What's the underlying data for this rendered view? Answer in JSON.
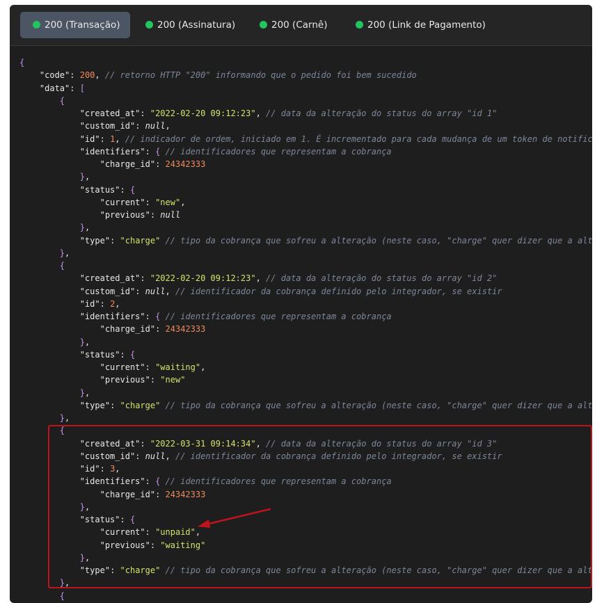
{
  "tabs": [
    {
      "label": "200 (Transação)",
      "active": true
    },
    {
      "label": "200 (Assinatura)",
      "active": false
    },
    {
      "label": "200 (Carnê)",
      "active": false
    },
    {
      "label": "200 (Link de Pagamento)",
      "active": false
    }
  ],
  "colors": {
    "status_dot": "#22c55e",
    "highlight_border": "#c0141b",
    "string": "#d5e36a",
    "number": "#f08a5d",
    "comment": "#7d8799"
  },
  "code_lines": [
    [
      [
        "b",
        "{"
      ]
    ],
    [
      [
        "p",
        "    "
      ],
      [
        "k",
        "\"code\""
      ],
      [
        "p",
        ": "
      ],
      [
        "n",
        "200"
      ],
      [
        "p",
        ", "
      ],
      [
        "c",
        "// retorno HTTP \"200\" informando que o pedido foi bem sucedido"
      ]
    ],
    [
      [
        "p",
        "    "
      ],
      [
        "k",
        "\"data\""
      ],
      [
        "p",
        ": "
      ],
      [
        "b",
        "["
      ]
    ],
    [
      [
        "p",
        "        "
      ],
      [
        "b",
        "{"
      ]
    ],
    [
      [
        "p",
        "            "
      ],
      [
        "k",
        "\"created_at\""
      ],
      [
        "p",
        ": "
      ],
      [
        "s",
        "\"2022-02-20 09:12:23\""
      ],
      [
        "p",
        ", "
      ],
      [
        "c",
        "// data da alteração do status do array \"id 1\""
      ]
    ],
    [
      [
        "p",
        "            "
      ],
      [
        "k",
        "\"custom_id\""
      ],
      [
        "p",
        ": "
      ],
      [
        "v",
        "null"
      ],
      [
        "p",
        ","
      ]
    ],
    [
      [
        "p",
        "            "
      ],
      [
        "k",
        "\"id\""
      ],
      [
        "p",
        ": "
      ],
      [
        "n",
        "1"
      ],
      [
        "p",
        ", "
      ],
      [
        "c",
        "// indicador de ordem, iniciado em 1. É incrementado para cada mudança de um token de notificação."
      ]
    ],
    [
      [
        "p",
        "            "
      ],
      [
        "k",
        "\"identifiers\""
      ],
      [
        "p",
        ": "
      ],
      [
        "b",
        "{"
      ],
      [
        "p",
        " "
      ],
      [
        "c",
        "// identificadores que representam a cobrança"
      ]
    ],
    [
      [
        "p",
        "                "
      ],
      [
        "k",
        "\"charge_id\""
      ],
      [
        "p",
        ": "
      ],
      [
        "n",
        "24342333"
      ]
    ],
    [
      [
        "p",
        "            "
      ],
      [
        "b",
        "}"
      ],
      [
        "p",
        ","
      ]
    ],
    [
      [
        "p",
        "            "
      ],
      [
        "k",
        "\"status\""
      ],
      [
        "p",
        ": "
      ],
      [
        "b",
        "{"
      ]
    ],
    [
      [
        "p",
        "                "
      ],
      [
        "k",
        "\"current\""
      ],
      [
        "p",
        ": "
      ],
      [
        "s",
        "\"new\""
      ],
      [
        "p",
        ","
      ]
    ],
    [
      [
        "p",
        "                "
      ],
      [
        "k",
        "\"previous\""
      ],
      [
        "p",
        ": "
      ],
      [
        "v",
        "null"
      ]
    ],
    [
      [
        "p",
        "            "
      ],
      [
        "b",
        "}"
      ],
      [
        "p",
        ","
      ]
    ],
    [
      [
        "p",
        "            "
      ],
      [
        "k",
        "\"type\""
      ],
      [
        "p",
        ": "
      ],
      [
        "s",
        "\"charge\""
      ],
      [
        "p",
        " "
      ],
      [
        "c",
        "// tipo da cobrança que sofreu a alteração (neste caso, \"charge\" quer dizer que a alteração"
      ]
    ],
    [
      [
        "p",
        "        "
      ],
      [
        "b",
        "}"
      ],
      [
        "p",
        ","
      ]
    ],
    [
      [
        "p",
        "        "
      ],
      [
        "b",
        "{"
      ]
    ],
    [
      [
        "p",
        "            "
      ],
      [
        "k",
        "\"created_at\""
      ],
      [
        "p",
        ": "
      ],
      [
        "s",
        "\"2022-02-20 09:12:23\""
      ],
      [
        "p",
        ", "
      ],
      [
        "c",
        "// data da alteração do status do array \"id 2\""
      ]
    ],
    [
      [
        "p",
        "            "
      ],
      [
        "k",
        "\"custom_id\""
      ],
      [
        "p",
        ": "
      ],
      [
        "v",
        "null"
      ],
      [
        "p",
        ", "
      ],
      [
        "c",
        "// identificador da cobrança definido pelo integrador, se existir"
      ]
    ],
    [
      [
        "p",
        "            "
      ],
      [
        "k",
        "\"id\""
      ],
      [
        "p",
        ": "
      ],
      [
        "n",
        "2"
      ],
      [
        "p",
        ","
      ]
    ],
    [
      [
        "p",
        "            "
      ],
      [
        "k",
        "\"identifiers\""
      ],
      [
        "p",
        ": "
      ],
      [
        "b",
        "{"
      ],
      [
        "p",
        " "
      ],
      [
        "c",
        "// identificadores que representam a cobrança"
      ]
    ],
    [
      [
        "p",
        "                "
      ],
      [
        "k",
        "\"charge_id\""
      ],
      [
        "p",
        ": "
      ],
      [
        "n",
        "24342333"
      ]
    ],
    [
      [
        "p",
        "            "
      ],
      [
        "b",
        "}"
      ],
      [
        "p",
        ","
      ]
    ],
    [
      [
        "p",
        "            "
      ],
      [
        "k",
        "\"status\""
      ],
      [
        "p",
        ": "
      ],
      [
        "b",
        "{"
      ]
    ],
    [
      [
        "p",
        "                "
      ],
      [
        "k",
        "\"current\""
      ],
      [
        "p",
        ": "
      ],
      [
        "s",
        "\"waiting\""
      ],
      [
        "p",
        ","
      ]
    ],
    [
      [
        "p",
        "                "
      ],
      [
        "k",
        "\"previous\""
      ],
      [
        "p",
        ": "
      ],
      [
        "s",
        "\"new\""
      ]
    ],
    [
      [
        "p",
        "            "
      ],
      [
        "b",
        "}"
      ],
      [
        "p",
        ","
      ]
    ],
    [
      [
        "p",
        "            "
      ],
      [
        "k",
        "\"type\""
      ],
      [
        "p",
        ": "
      ],
      [
        "s",
        "\"charge\""
      ],
      [
        "p",
        " "
      ],
      [
        "c",
        "// tipo da cobrança que sofreu a alteração (neste caso, \"charge\" quer dizer que a alteração"
      ]
    ],
    [
      [
        "p",
        "        "
      ],
      [
        "b",
        "}"
      ],
      [
        "p",
        ","
      ]
    ],
    [
      [
        "p",
        "        "
      ],
      [
        "b",
        "{"
      ]
    ],
    [
      [
        "p",
        "            "
      ],
      [
        "k",
        "\"created_at\""
      ],
      [
        "p",
        ": "
      ],
      [
        "s",
        "\"2022-03-31 09:14:34\""
      ],
      [
        "p",
        ", "
      ],
      [
        "c",
        "// data da alteração do status do array \"id 3\""
      ]
    ],
    [
      [
        "p",
        "            "
      ],
      [
        "k",
        "\"custom_id\""
      ],
      [
        "p",
        ": "
      ],
      [
        "v",
        "null"
      ],
      [
        "p",
        ", "
      ],
      [
        "c",
        "// identificador da cobrança definido pelo integrador, se existir"
      ]
    ],
    [
      [
        "p",
        "            "
      ],
      [
        "k",
        "\"id\""
      ],
      [
        "p",
        ": "
      ],
      [
        "n",
        "3"
      ],
      [
        "p",
        ","
      ]
    ],
    [
      [
        "p",
        "            "
      ],
      [
        "k",
        "\"identifiers\""
      ],
      [
        "p",
        ": "
      ],
      [
        "b",
        "{"
      ],
      [
        "p",
        " "
      ],
      [
        "c",
        "// identificadores que representam a cobrança"
      ]
    ],
    [
      [
        "p",
        "                "
      ],
      [
        "k",
        "\"charge_id\""
      ],
      [
        "p",
        ": "
      ],
      [
        "n",
        "24342333"
      ]
    ],
    [
      [
        "p",
        "            "
      ],
      [
        "b",
        "}"
      ],
      [
        "p",
        ","
      ]
    ],
    [
      [
        "p",
        "            "
      ],
      [
        "k",
        "\"status\""
      ],
      [
        "p",
        ": "
      ],
      [
        "b",
        "{"
      ]
    ],
    [
      [
        "p",
        "                "
      ],
      [
        "k",
        "\"current\""
      ],
      [
        "p",
        ": "
      ],
      [
        "s",
        "\"unpaid\""
      ],
      [
        "p",
        ","
      ]
    ],
    [
      [
        "p",
        "                "
      ],
      [
        "k",
        "\"previous\""
      ],
      [
        "p",
        ": "
      ],
      [
        "s",
        "\"waiting\""
      ]
    ],
    [
      [
        "p",
        "            "
      ],
      [
        "b",
        "}"
      ],
      [
        "p",
        ","
      ]
    ],
    [
      [
        "p",
        "            "
      ],
      [
        "k",
        "\"type\""
      ],
      [
        "p",
        ": "
      ],
      [
        "s",
        "\"charge\""
      ],
      [
        "p",
        " "
      ],
      [
        "c",
        "// tipo da cobrança que sofreu a alteração (neste caso, \"charge\" quer dizer que a alteração"
      ]
    ],
    [
      [
        "p",
        "        "
      ],
      [
        "b",
        "}"
      ],
      [
        "p",
        ","
      ]
    ],
    [
      [
        "p",
        "        "
      ],
      [
        "b",
        "{"
      ]
    ]
  ]
}
